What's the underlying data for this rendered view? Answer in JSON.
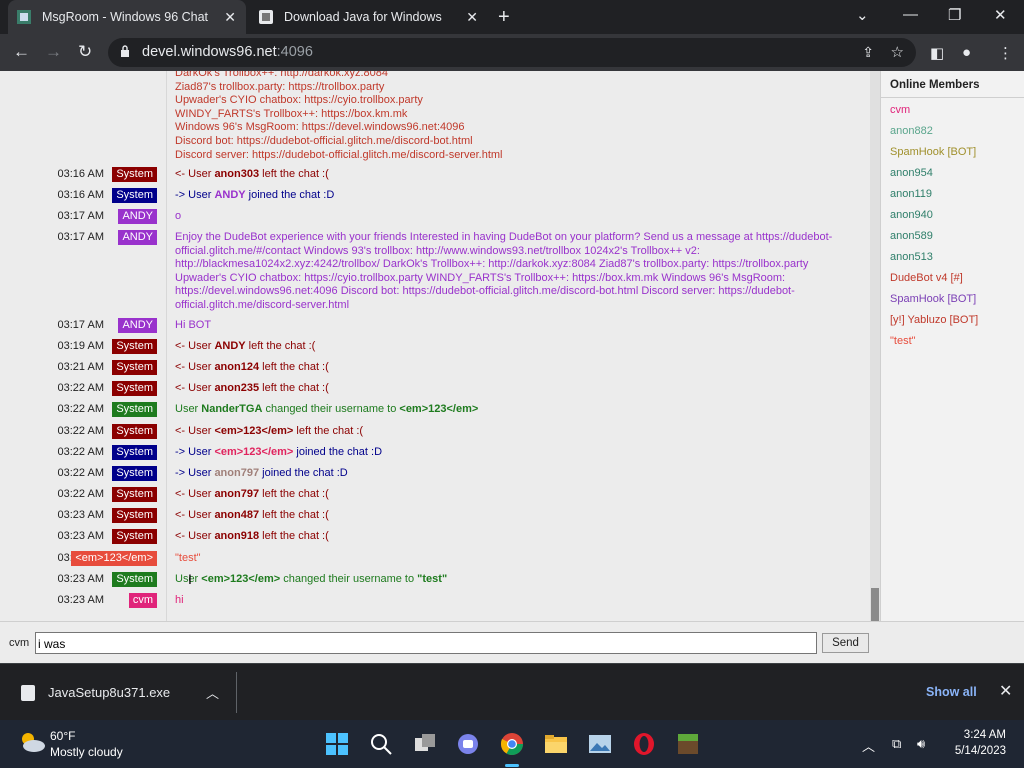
{
  "browser": {
    "tabs": [
      {
        "title": "MsgRoom - Windows 96 Chat"
      },
      {
        "title": "Download Java for Windows"
      }
    ],
    "url_host": "devel.windows96.net",
    "url_port": ":4096"
  },
  "chat": {
    "top_block": [
      {
        "text": "DarkOk's Trollbox++: http://darkok.xyz:8084",
        "color": "#c0392b"
      },
      {
        "text": "Ziad87's trollbox.party: https://trollbox.party",
        "color": "#c0392b"
      },
      {
        "text": "Upwader's CYIO chatbox: https://cyio.trollbox.party",
        "color": "#c0392b"
      },
      {
        "text": "WINDY_FARTS's Trollbox++: https://box.km.mk",
        "color": "#c0392b"
      },
      {
        "text": "Windows 96's MsgRoom: https://devel.windows96.net:4096",
        "color": "#c0392b"
      },
      {
        "text": "Discord bot: https://dudebot-official.glitch.me/discord-bot.html",
        "color": "#c0392b"
      },
      {
        "text": "Discord server: https://dudebot-official.glitch.me/discord-server.html",
        "color": "#c0392b"
      }
    ],
    "messages": [
      {
        "time": "03:16 AM",
        "badge": "System",
        "badge_color": "#8b0000",
        "pre": "<- User ",
        "user": "anon303",
        "user_color": "#8b0000",
        "post": " left the chat :(",
        "text_color": "#8b0000"
      },
      {
        "time": "03:16 AM",
        "badge": "System",
        "badge_color": "#00008b",
        "pre": "-> User ",
        "user": "ANDY",
        "user_color": "#9932cc",
        "post": " joined the chat :D",
        "text_color": "#00008b"
      },
      {
        "time": "03:17 AM",
        "badge": "ANDY",
        "badge_color": "#9932cc",
        "pre": "o",
        "user": "",
        "user_color": "#9932cc",
        "post": "",
        "text_color": "#9932cc"
      },
      {
        "time": "03:17 AM",
        "badge": "ANDY",
        "badge_color": "#9932cc",
        "pre": "",
        "user": "",
        "user_color": "#9932cc",
        "post": "",
        "text_color": "#9932cc"
      },
      {
        "time": "03:17 AM",
        "badge": "ANDY",
        "badge_color": "#9932cc",
        "pre": "Hi BOT",
        "user": "",
        "user_color": "#9932cc",
        "post": "",
        "text_color": "#9932cc"
      },
      {
        "time": "03:19 AM",
        "badge": "System",
        "badge_color": "#8b0000",
        "pre": "<- User ",
        "user": "ANDY",
        "user_color": "#8b0000",
        "post": " left the chat :(",
        "text_color": "#8b0000"
      },
      {
        "time": "03:21 AM",
        "badge": "System",
        "badge_color": "#8b0000",
        "pre": "<- User ",
        "user": "anon124",
        "user_color": "#8b0000",
        "post": " left the chat :(",
        "text_color": "#8b0000"
      },
      {
        "time": "03:22 AM",
        "badge": "System",
        "badge_color": "#8b0000",
        "pre": "<- User ",
        "user": "anon235",
        "user_color": "#8b0000",
        "post": " left the chat :(",
        "text_color": "#8b0000"
      },
      {
        "time": "03:22 AM",
        "badge": "System",
        "badge_color": "#1e7b1e",
        "pre": "User ",
        "user": "NanderTGA",
        "user_color": "#1e7b1e",
        "post": " changed their username to ",
        "extra": "<em>123</em>",
        "extra_color": "#1e7b1e",
        "text_color": "#1e7b1e"
      },
      {
        "time": "03:22 AM",
        "badge": "System",
        "badge_color": "#8b0000",
        "pre": "<- User ",
        "user": "<em>123</em>",
        "user_color": "#8b0000",
        "post": " left the chat :(",
        "text_color": "#8b0000"
      },
      {
        "time": "03:22 AM",
        "badge": "System",
        "badge_color": "#00008b",
        "pre": "-> User ",
        "user": "<em>123</em>",
        "user_color": "#e0245e",
        "post": " joined the chat :D",
        "text_color": "#00008b"
      },
      {
        "time": "03:22 AM",
        "badge": "System",
        "badge_color": "#00008b",
        "pre": "-> User ",
        "user": "anon797",
        "user_color": "#a0807a",
        "post": " joined the chat :D",
        "text_color": "#00008b"
      },
      {
        "time": "03:22 AM",
        "badge": "System",
        "badge_color": "#8b0000",
        "pre": "<- User ",
        "user": "anon797",
        "user_color": "#8b0000",
        "post": " left the chat :(",
        "text_color": "#8b0000"
      },
      {
        "time": "03:23 AM",
        "badge": "System",
        "badge_color": "#8b0000",
        "pre": "<- User ",
        "user": "anon487",
        "user_color": "#8b0000",
        "post": " left the chat :(",
        "text_color": "#8b0000"
      },
      {
        "time": "03:23 AM",
        "badge": "System",
        "badge_color": "#8b0000",
        "pre": "<- User ",
        "user": "anon918",
        "user_color": "#8b0000",
        "post": " left the chat :(",
        "text_color": "#8b0000"
      },
      {
        "time": "03:23 AM",
        "badge": "<em>123</em>",
        "badge_color": "#e74c3c",
        "pre": "\"test\"",
        "user": "",
        "user_color": "#e74c3c",
        "post": "",
        "text_color": "#e74c3c"
      },
      {
        "time": "03:23 AM",
        "badge": "System",
        "badge_color": "#1e7b1e",
        "pre": "User ",
        "user": "<em>123</em>",
        "user_color": "#1e7b1e",
        "post": " changed their username to ",
        "extra": "\"test\"",
        "extra_color": "#1e7b1e",
        "text_color": "#1e7b1e"
      },
      {
        "time": "03:23 AM",
        "badge": "cvm",
        "badge_color": "#e0247a",
        "pre": "hi",
        "user": "",
        "user_color": "#e0247a",
        "post": "",
        "text_color": "#e0247a"
      }
    ],
    "bot_block": "Enjoy the DudeBot experience with your friends Interested in having DudeBot on your platform? Send us a message at https://dudebot-official.glitch.me/#/contact  Windows 93's trollbox: http://www.windows93.net/trollbox 1024x2's Trollbox++ v2: http://blackmesa1024x2.xyz:4242/trollbox/ DarkOk's Trollbox++: http://darkok.xyz:8084 Ziad87's trollbox.party: https://trollbox.party Upwader's CYIO chatbox: https://cyio.trollbox.party WINDY_FARTS's Trollbox++: https://box.km.mk Windows 96's MsgRoom: https://devel.windows96.net:4096 Discord bot: https://dudebot-official.glitch.me/discord-bot.html Discord server: https://dudebot-official.glitch.me/discord-server.html",
    "bot_block_color": "#9932cc"
  },
  "members": {
    "title": "Online Members",
    "list": [
      {
        "name": "cvm",
        "color": "#e0247a"
      },
      {
        "name": "anon882",
        "color": "#5aa58c"
      },
      {
        "name": "SpamHook [BOT]",
        "color": "#a0902c"
      },
      {
        "name": "anon954",
        "color": "#2f7f6a"
      },
      {
        "name": "anon119",
        "color": "#2f7f6a"
      },
      {
        "name": "anon940",
        "color": "#2f7f6a"
      },
      {
        "name": "anon589",
        "color": "#2f7f6a"
      },
      {
        "name": "anon513",
        "color": "#2f7f6a"
      },
      {
        "name": "DudeBot v4 [#]",
        "color": "#c0392b"
      },
      {
        "name": "SpamHook [BOT]",
        "color": "#7b3fb5"
      },
      {
        "name": "[y!] Yabluzo [BOT]",
        "color": "#c0392b"
      },
      {
        "name": "\"test\"",
        "color": "#e74c3c"
      }
    ]
  },
  "composer": {
    "nick": "cvm",
    "value": "i was",
    "send_label": "Send"
  },
  "downloads": {
    "file": "JavaSetup8u371.exe",
    "show_all": "Show all"
  },
  "taskbar": {
    "temp": "60°F",
    "weather": "Mostly cloudy",
    "time": "3:24 AM",
    "date": "5/14/2023"
  }
}
